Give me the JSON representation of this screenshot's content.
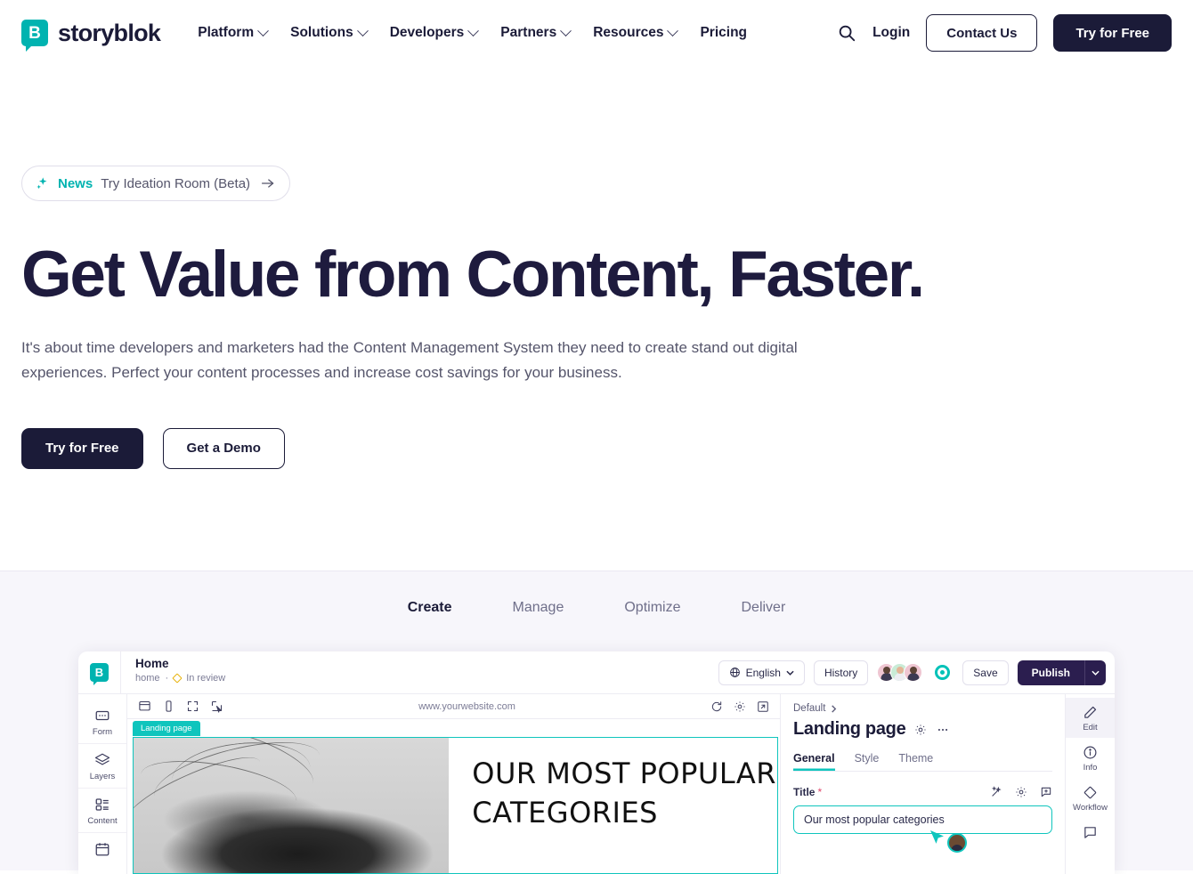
{
  "header": {
    "brand_letter": "B",
    "brand_name": "storyblok",
    "nav": [
      {
        "label": "Platform",
        "has_dropdown": true
      },
      {
        "label": "Solutions",
        "has_dropdown": true
      },
      {
        "label": "Developers",
        "has_dropdown": true
      },
      {
        "label": "Partners",
        "has_dropdown": true
      },
      {
        "label": "Resources",
        "has_dropdown": true
      },
      {
        "label": "Pricing",
        "has_dropdown": false
      }
    ],
    "search_icon": "search-icon",
    "login_label": "Login",
    "contact_label": "Contact Us",
    "trial_label": "Try for Free"
  },
  "hero": {
    "badge": {
      "icon": "sparkle-icon",
      "label": "News",
      "text": "Try Ideation Room (Beta)",
      "arrow_icon": "arrow-right-icon"
    },
    "title": "Get Value from Content, Faster.",
    "subtitle": "It's about time developers and marketers had the Content Management System they need to create stand out digital experiences. Perfect your content processes and increase cost savings for your business.",
    "primary_cta": "Try for Free",
    "secondary_cta": "Get a Demo"
  },
  "showcase": {
    "tabs": [
      {
        "label": "Create",
        "active": true
      },
      {
        "label": "Manage",
        "active": false
      },
      {
        "label": "Optimize",
        "active": false
      },
      {
        "label": "Deliver",
        "active": false
      }
    ],
    "app": {
      "logo_letter": "B",
      "breadcrumb_title": "Home",
      "breadcrumb_path": "home",
      "breadcrumb_separator": "·",
      "status_label": "In review",
      "status_color": "#E8B411",
      "language": "English",
      "history_label": "History",
      "save_label": "Save",
      "publish_label": "Publish",
      "left_rail": [
        {
          "icon": "form-icon",
          "label": "Form"
        },
        {
          "icon": "layers-icon",
          "label": "Layers"
        },
        {
          "icon": "content-icon",
          "label": "Content"
        },
        {
          "icon": "calendar-icon",
          "label": ""
        }
      ],
      "preview": {
        "toolbar_icons": [
          "desktop-icon",
          "mobile-icon",
          "fullscreen-icon",
          "pointer-icon"
        ],
        "url": "www.yourwebsite.com",
        "right_icons": [
          "refresh-icon",
          "gear-icon",
          "open-external-icon"
        ],
        "block_tag": "Landing page",
        "heading": "OUR MOST POPULAR CATEGORIES",
        "accent_color": "#0FC5BD"
      },
      "panel": {
        "breadcrumb": "Default",
        "title": "Landing page",
        "tabs": [
          {
            "label": "General",
            "active": true
          },
          {
            "label": "Style",
            "active": false
          },
          {
            "label": "Theme",
            "active": false
          }
        ],
        "field_label": "Title",
        "field_required_marker": "*",
        "field_icons": [
          "magic-wand-icon",
          "gear-icon",
          "comment-add-icon"
        ],
        "field_value": "Our most popular categories"
      },
      "right_rail": [
        {
          "icon": "pencil-icon",
          "label": "Edit",
          "active": true
        },
        {
          "icon": "info-icon",
          "label": "Info",
          "active": false
        },
        {
          "icon": "workflow-icon",
          "label": "Workflow",
          "active": false
        },
        {
          "icon": "comment-icon",
          "label": "",
          "active": false
        }
      ]
    }
  },
  "colors": {
    "brand_teal": "#00B3B0",
    "accent_teal": "#0FC5BD",
    "dark_navy": "#1B1B38",
    "publish_purple": "#2B1E4F",
    "section_bg": "#F7F6FB"
  }
}
